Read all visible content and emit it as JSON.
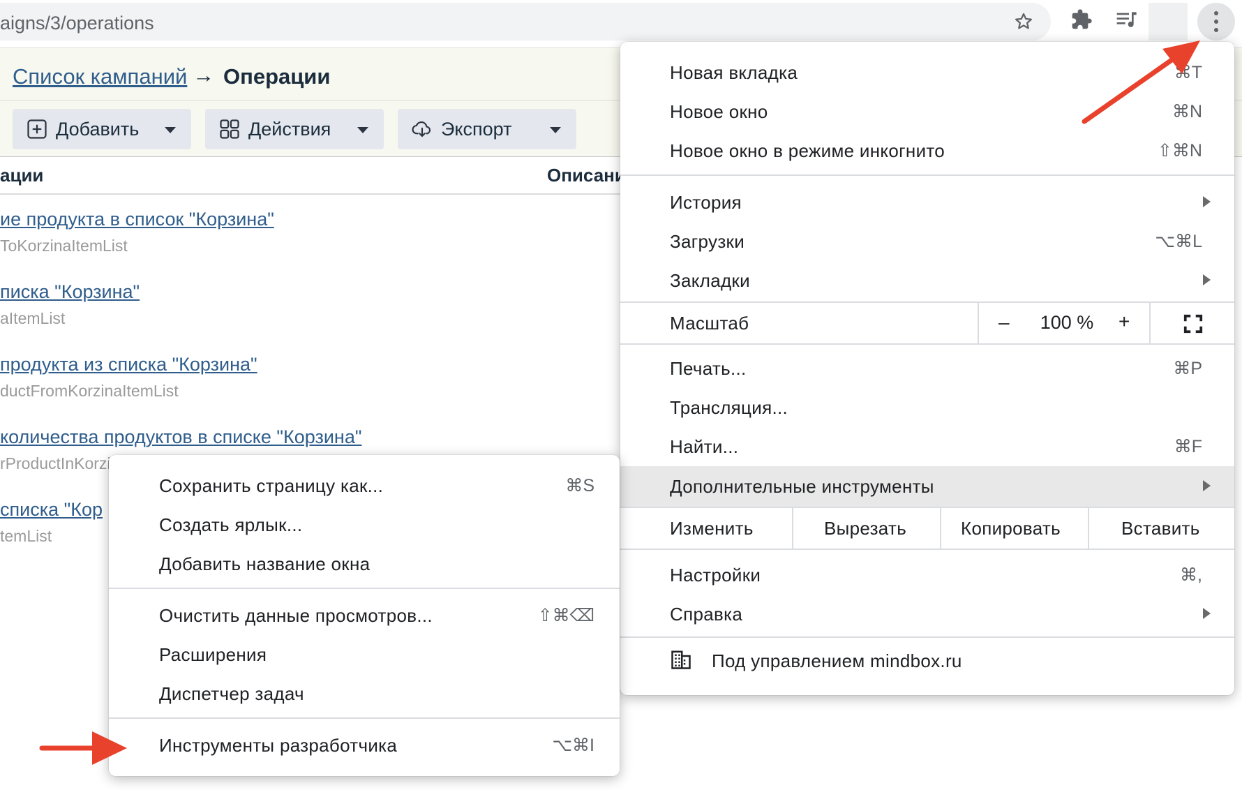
{
  "browser": {
    "url": "aigns/3/operations"
  },
  "page": {
    "breadcrumb": {
      "link": "Список кампаний",
      "arrow": "→",
      "current": "Операции"
    },
    "toolbar": {
      "add": "Добавить",
      "actions": "Действия",
      "export": "Экспорт"
    },
    "columns": {
      "name": "ации",
      "description": "Описани"
    },
    "operations": [
      {
        "title": "ие продукта в список \"Корзина\"",
        "system": "ToKorzinaItemList"
      },
      {
        "title": "писка \"Корзина\"",
        "system": "aItemList"
      },
      {
        "title": "продукта из списка \"Корзина\"",
        "system": "ductFromKorzinaItemList"
      },
      {
        "title": " количества продуктов в списке \"Корзина\"",
        "system": "rProductInKorzi"
      },
      {
        "title": " списка \"Кор",
        "system": "temList"
      }
    ]
  },
  "main_menu": {
    "new_tab": {
      "label": "Новая вкладка",
      "shortcut": "⌘T"
    },
    "new_window": {
      "label": "Новое окно",
      "shortcut": "⌘N"
    },
    "incognito": {
      "label": "Новое окно в режиме инкогнито",
      "shortcut": "⇧⌘N"
    },
    "history": {
      "label": "История"
    },
    "downloads": {
      "label": "Загрузки",
      "shortcut": "⌥⌘L"
    },
    "bookmarks": {
      "label": "Закладки"
    },
    "zoom": {
      "label": "Масштаб",
      "minus": "–",
      "value": "100 %",
      "plus": "+"
    },
    "print": {
      "label": "Печать...",
      "shortcut": "⌘P"
    },
    "cast": {
      "label": "Трансляция..."
    },
    "find": {
      "label": "Найти...",
      "shortcut": "⌘F"
    },
    "more_tools": {
      "label": "Дополнительные инструменты"
    },
    "edit": {
      "label": "Изменить",
      "cut": "Вырезать",
      "copy": "Копировать",
      "paste": "Вставить"
    },
    "settings": {
      "label": "Настройки",
      "shortcut": "⌘,"
    },
    "help": {
      "label": "Справка"
    },
    "managed": {
      "label": "Под управлением mindbox.ru"
    }
  },
  "sub_menu": {
    "save_page": {
      "label": "Сохранить страницу как...",
      "shortcut": "⌘S"
    },
    "create_shortcut": {
      "label": "Создать ярлык..."
    },
    "name_window": {
      "label": "Добавить название окна"
    },
    "clear_data": {
      "label": "Очистить данные просмотров...",
      "shortcut": "⇧⌘⌫"
    },
    "extensions": {
      "label": "Расширения"
    },
    "task_manager": {
      "label": "Диспетчер задач"
    },
    "dev_tools": {
      "label": "Инструменты разработчика",
      "shortcut": "⌥⌘I"
    }
  },
  "colors": {
    "annotation_arrow": "#e8412c",
    "link": "#2f5d8c",
    "menu_highlight": "#e8e8e8"
  }
}
